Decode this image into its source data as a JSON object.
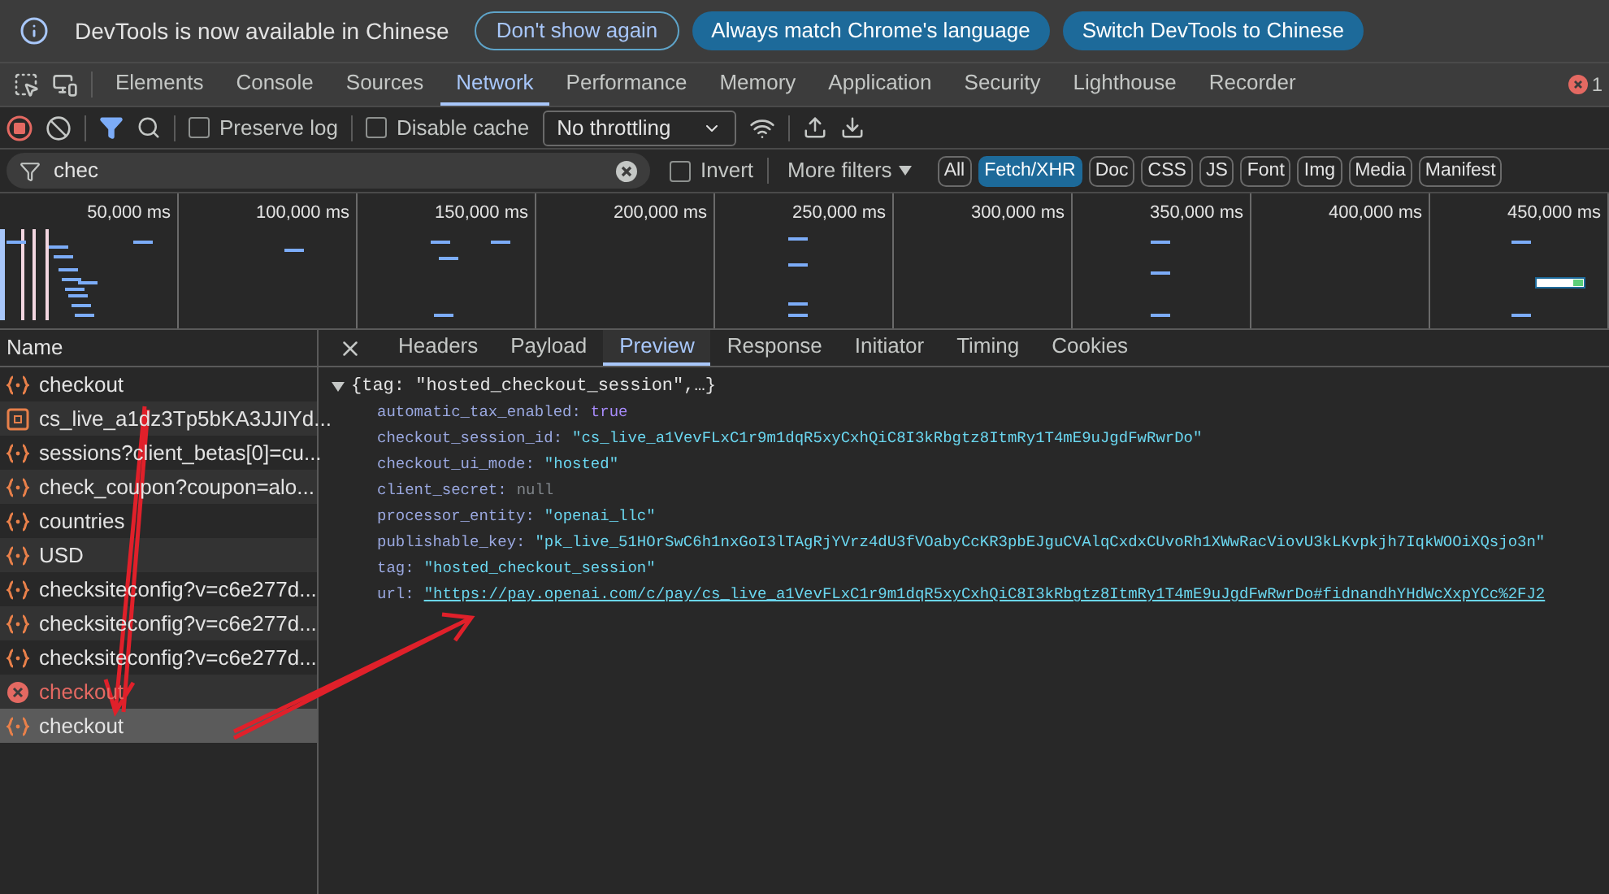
{
  "infobar": {
    "message": "DevTools is now available in Chinese",
    "buttons": [
      {
        "label": "Don't show again",
        "kind": "outline"
      },
      {
        "label": "Always match Chrome's language",
        "kind": "filled"
      },
      {
        "label": "Switch DevTools to Chinese",
        "kind": "filled"
      }
    ]
  },
  "panel_tabs": [
    {
      "label": "Elements",
      "selected": false
    },
    {
      "label": "Console",
      "selected": false
    },
    {
      "label": "Sources",
      "selected": false
    },
    {
      "label": "Network",
      "selected": true
    },
    {
      "label": "Performance",
      "selected": false
    },
    {
      "label": "Memory",
      "selected": false
    },
    {
      "label": "Application",
      "selected": false
    },
    {
      "label": "Security",
      "selected": false
    },
    {
      "label": "Lighthouse",
      "selected": false
    },
    {
      "label": "Recorder",
      "selected": false
    }
  ],
  "error_count": "1",
  "toolbar": {
    "recording": true,
    "preserve_log": {
      "label": "Preserve log",
      "checked": false
    },
    "disable_cache": {
      "label": "Disable cache",
      "checked": false
    },
    "throttling": "No throttling"
  },
  "filter": {
    "value": "chec",
    "invert": {
      "label": "Invert",
      "checked": false
    },
    "more_filters": "More filters",
    "chips": [
      {
        "label": "All",
        "selected": false
      },
      {
        "label": "Fetch/XHR",
        "selected": true
      },
      {
        "label": "Doc",
        "selected": false
      },
      {
        "label": "CSS",
        "selected": false
      },
      {
        "label": "JS",
        "selected": false
      },
      {
        "label": "Font",
        "selected": false
      },
      {
        "label": "Img",
        "selected": false
      },
      {
        "label": "Media",
        "selected": false
      },
      {
        "label": "Manifest",
        "selected": false
      }
    ]
  },
  "overview": {
    "ticks": [
      "50,000 ms",
      "100,000 ms",
      "150,000 ms",
      "200,000 ms",
      "250,000 ms",
      "300,000 ms",
      "350,000 ms",
      "400,000 ms",
      "450,000 ms"
    ]
  },
  "requests": {
    "column": "Name",
    "rows": [
      {
        "name": "checkout",
        "kind": "json",
        "selected": false
      },
      {
        "name": "cs_live_a1dz3Tp5bKA3JJIYd...",
        "kind": "doc",
        "selected": false
      },
      {
        "name": "sessions?client_betas[0]=cu...",
        "kind": "json",
        "selected": false
      },
      {
        "name": "check_coupon?coupon=alo...",
        "kind": "json",
        "selected": false
      },
      {
        "name": "countries",
        "kind": "json",
        "selected": false
      },
      {
        "name": "USD",
        "kind": "json",
        "selected": false
      },
      {
        "name": "checksiteconfig?v=c6e277d...",
        "kind": "json",
        "selected": false
      },
      {
        "name": "checksiteconfig?v=c6e277d...",
        "kind": "json",
        "selected": false
      },
      {
        "name": "checksiteconfig?v=c6e277d...",
        "kind": "json",
        "selected": false
      },
      {
        "name": "checkout",
        "kind": "error",
        "selected": false
      },
      {
        "name": "checkout",
        "kind": "json",
        "selected": true
      }
    ]
  },
  "detail_tabs": [
    {
      "label": "Headers",
      "selected": false
    },
    {
      "label": "Payload",
      "selected": false
    },
    {
      "label": "Preview",
      "selected": true
    },
    {
      "label": "Response",
      "selected": false
    },
    {
      "label": "Initiator",
      "selected": false
    },
    {
      "label": "Timing",
      "selected": false
    },
    {
      "label": "Cookies",
      "selected": false
    }
  ],
  "preview": {
    "summary": "{tag: \"hosted_checkout_session\",…}",
    "expanded": true,
    "properties": [
      {
        "key": "automatic_tax_enabled:",
        "value": "true",
        "kind": "boolean"
      },
      {
        "key": "checkout_session_id:",
        "value": "\"cs_live_a1VevFLxC1r9m1dqR5xyCxhQiC8I3kRbgtz8ItmRy1T4mE9uJgdFwRwrDo\"",
        "kind": "string"
      },
      {
        "key": "checkout_ui_mode:",
        "value": "\"hosted\"",
        "kind": "string"
      },
      {
        "key": "client_secret:",
        "value": "null",
        "kind": "null"
      },
      {
        "key": "processor_entity:",
        "value": "\"openai_llc\"",
        "kind": "string"
      },
      {
        "key": "publishable_key:",
        "value": "\"pk_live_51HOrSwC6h1nxGoI3lTAgRjYVrz4dU3fVOabyCcKR3pbEJguCVAlqCxdxCUvoRh1XWwRacViovU3kLKvpkjh7IqkWOOiXQsjo3n\"",
        "kind": "string"
      },
      {
        "key": "tag:",
        "value": "\"hosted_checkout_session\"",
        "kind": "string"
      },
      {
        "key": "url:",
        "value": "\"https://pay.openai.com/c/pay/cs_live_a1VevFLxC1r9m1dqR5xyCxhQiC8I3kRbgtz8ItmRy1T4mE9uJgdFwRwrDo#fidnandhYHdWcXxpYCc%2FJ2",
        "kind": "link"
      }
    ]
  }
}
